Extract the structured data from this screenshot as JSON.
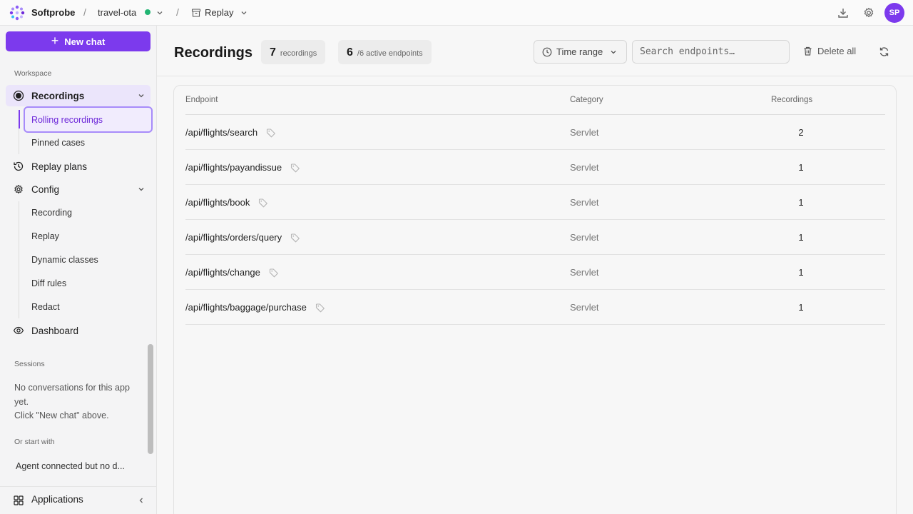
{
  "topbar": {
    "brand": "Softprobe",
    "separator": "/",
    "app_name": "travel-ota",
    "page_name": "Replay",
    "avatar_initials": "SP",
    "status_color": "#22b573"
  },
  "sidebar": {
    "new_chat_label": "New chat",
    "workspace_label": "Workspace",
    "recordings_label": "Recordings",
    "recordings_sub": [
      "Rolling recordings",
      "Pinned cases"
    ],
    "replay_plans_label": "Replay plans",
    "config_label": "Config",
    "config_sub": [
      "Recording",
      "Replay",
      "Dynamic classes",
      "Diff rules",
      "Redact"
    ],
    "dashboard_label": "Dashboard",
    "sessions_label": "Sessions",
    "sessions_empty_line1": "No conversations for this app yet.",
    "sessions_empty_line2": "Click \"New chat\" above.",
    "start_with_label": "Or start with",
    "start_item": "Agent connected but no d...",
    "applications_label": "Applications"
  },
  "main": {
    "title": "Recordings",
    "stats": [
      {
        "num": "7",
        "label": "recordings"
      },
      {
        "num": "6",
        "label": "/6 active endpoints"
      }
    ],
    "time_range_label": "Time range",
    "search_placeholder": "Search endpoints…",
    "delete_all_label": "Delete all",
    "table": {
      "headers": {
        "endpoint": "Endpoint",
        "category": "Category",
        "recordings": "Recordings"
      },
      "rows": [
        {
          "endpoint": "/api/flights/search",
          "category": "Servlet",
          "count": "2"
        },
        {
          "endpoint": "/api/flights/payandissue",
          "category": "Servlet",
          "count": "1"
        },
        {
          "endpoint": "/api/flights/book",
          "category": "Servlet",
          "count": "1"
        },
        {
          "endpoint": "/api/flights/orders/query",
          "category": "Servlet",
          "count": "1"
        },
        {
          "endpoint": "/api/flights/change",
          "category": "Servlet",
          "count": "1"
        },
        {
          "endpoint": "/api/flights/baggage/purchase",
          "category": "Servlet",
          "count": "1"
        }
      ]
    }
  },
  "colors": {
    "accent": "#7c3aed"
  }
}
